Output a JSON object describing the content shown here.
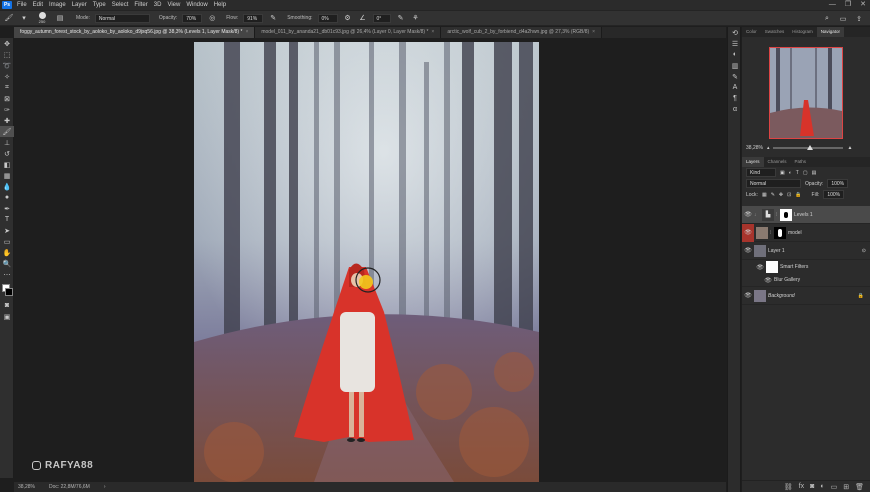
{
  "menubar": {
    "logo": "Ps",
    "items": [
      "File",
      "Edit",
      "Image",
      "Layer",
      "Type",
      "Select",
      "Filter",
      "3D",
      "View",
      "Window",
      "Help"
    ]
  },
  "options": {
    "brush_size": "250",
    "mode_label": "Mode:",
    "mode_value": "Normal",
    "opacity_label": "Opacity:",
    "opacity_value": "70%",
    "flow_label": "Flow:",
    "flow_value": "91%",
    "smoothing_label": "Smoothing:",
    "smoothing_value": "0%",
    "angle_value": "0°"
  },
  "tabs": [
    {
      "label": "foggy_autumn_forest_stock_by_aoloko_by_aoloko_d9jsq56.jpg @ 38,3% (Levels 1, Layer Mask/8) *",
      "active": true
    },
    {
      "label": "model_011_by_ananda21_db01c93.jpg @ 26,4% (Layer 0, Layer Mask/8) *",
      "active": false
    },
    {
      "label": "arctic_wolf_cub_2_by_forbiend_d4a2hwn.jpg @ 27,3% (RGB/8)",
      "active": false
    }
  ],
  "status": {
    "zoom": "38,28%",
    "doc": "Doc: 22,8M/76,6M"
  },
  "watermark": "RAFYA88",
  "panels": {
    "top_tabs": [
      "Color",
      "Swatches",
      "Histogram",
      "Navigator"
    ],
    "nav_zoom": "38,28%",
    "layer_tabs": [
      "Layers",
      "Channels",
      "Paths"
    ],
    "kind_filter": "Kind",
    "blend_mode": "Normal",
    "opacity_label": "Opacity:",
    "opacity_value": "100%",
    "lock_label": "Lock:",
    "fill_label": "Fill:",
    "fill_value": "100%",
    "layers": [
      {
        "name": "Levels 1",
        "type": "adjustment",
        "selected": true
      },
      {
        "name": "model",
        "type": "masked"
      },
      {
        "name": "Layer 1",
        "type": "smart"
      },
      {
        "name": "Smart Filters",
        "type": "filters"
      },
      {
        "name": "Blur Gallery",
        "type": "filter"
      },
      {
        "name": "Background",
        "type": "background"
      }
    ]
  },
  "colors": {
    "accent": "#1473e6",
    "selection_red": "#c0392b"
  }
}
